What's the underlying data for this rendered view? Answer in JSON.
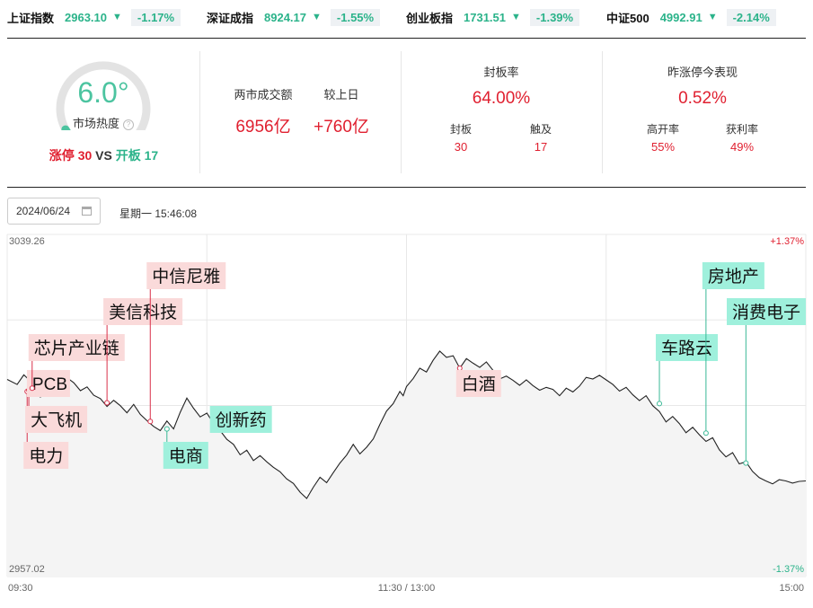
{
  "ticker": [
    {
      "name": "上证指数",
      "value": "2963.10",
      "arrow": "▼",
      "pct": "-1.17%"
    },
    {
      "name": "深证成指",
      "value": "8924.17",
      "arrow": "▼",
      "pct": "-1.55%"
    },
    {
      "name": "创业板指",
      "value": "1731.51",
      "arrow": "▼",
      "pct": "-1.39%"
    },
    {
      "name": "中证500",
      "value": "4992.91",
      "arrow": "▼",
      "pct": "-2.14%"
    }
  ],
  "heat": {
    "value": "6.0°",
    "value_num": 6.0,
    "label": "市场热度",
    "help_icon": "?",
    "limit_up_label": "涨停",
    "limit_up_count": "30",
    "vs": "VS",
    "open_label": "开板",
    "open_count": "17"
  },
  "turnover": {
    "label": "两市成交额",
    "value": "6956亿",
    "change_label": "较上日",
    "change_value": "+760亿"
  },
  "seal": {
    "label": "封板率",
    "value": "64.00%",
    "sealed_label": "封板",
    "sealed_value": "30",
    "touched_label": "触及",
    "touched_value": "17"
  },
  "yesterday": {
    "label": "昨涨停今表现",
    "value": "0.52%",
    "high_open_label": "高开率",
    "high_open_value": "55%",
    "profit_label": "获利率",
    "profit_value": "49%"
  },
  "date_picker": {
    "value": "2024/06/24",
    "icon": "calendar-icon"
  },
  "timestamp": "星期一 15:46:08",
  "chart_data": {
    "type": "line",
    "y_top_label": "3039.26",
    "y_bottom_label": "2957.02",
    "ylim": [
      2957.02,
      3039.26
    ],
    "right_top_label": "+1.37%",
    "right_bottom_label": "-1.37%",
    "x_ticks": [
      "09:30",
      "11:30 / 13:00",
      "15:00"
    ],
    "x_range_minutes": [
      0,
      240
    ],
    "series": [
      {
        "values": [
          [
            0,
            3004.4
          ],
          [
            3,
            3003.2
          ],
          [
            5,
            3005.5
          ],
          [
            7,
            3004.0
          ],
          [
            8,
            3001.0
          ],
          [
            10,
            3000.2
          ],
          [
            12,
            3002.8
          ],
          [
            14,
            3004.6
          ],
          [
            16,
            3002.5
          ],
          [
            18,
            3004.8
          ],
          [
            20,
            3003.6
          ],
          [
            22,
            3001.7
          ],
          [
            24,
            3002.6
          ],
          [
            26,
            3000.6
          ],
          [
            28,
            2999.8
          ],
          [
            30,
            2997.9
          ],
          [
            32,
            2999.4
          ],
          [
            34,
            2998.1
          ],
          [
            36,
            2996.4
          ],
          [
            38,
            2998.4
          ],
          [
            40,
            2996.0
          ],
          [
            42,
            2994.5
          ],
          [
            44,
            2993.1
          ],
          [
            46,
            2992.1
          ],
          [
            48,
            2994.4
          ],
          [
            50,
            2992.5
          ],
          [
            52,
            2996.5
          ],
          [
            54,
            2999.9
          ],
          [
            56,
            2997.5
          ],
          [
            58,
            2995.4
          ],
          [
            60,
            2996.3
          ],
          [
            62,
            2993.8
          ],
          [
            64,
            2992.1
          ],
          [
            66,
            2990.0
          ],
          [
            68,
            2988.8
          ],
          [
            70,
            2986.3
          ],
          [
            72,
            2987.4
          ],
          [
            74,
            2984.9
          ],
          [
            76,
            2986.1
          ],
          [
            78,
            2984.6
          ],
          [
            80,
            2983.3
          ],
          [
            82,
            2982.2
          ],
          [
            84,
            2980.5
          ],
          [
            86,
            2979.4
          ],
          [
            88,
            2977.3
          ],
          [
            90,
            2975.8
          ],
          [
            92,
            2978.5
          ],
          [
            94,
            2980.9
          ],
          [
            96,
            2979.6
          ],
          [
            98,
            2982.0
          ],
          [
            100,
            2984.3
          ],
          [
            102,
            2986.2
          ],
          [
            104,
            2988.8
          ],
          [
            106,
            2986.5
          ],
          [
            108,
            2988.1
          ],
          [
            110,
            2990.1
          ],
          [
            112,
            2993.6
          ],
          [
            114,
            2996.8
          ],
          [
            116,
            2998.6
          ],
          [
            118,
            3001.5
          ],
          [
            119,
            3000.5
          ],
          [
            120,
            3002.7
          ],
          [
            122,
            3004.6
          ],
          [
            124,
            3007.1
          ],
          [
            126,
            3006.2
          ],
          [
            128,
            3009.0
          ],
          [
            130,
            3011.2
          ],
          [
            132,
            3009.7
          ],
          [
            134,
            3010.1
          ],
          [
            136,
            3007.1
          ],
          [
            138,
            3009.4
          ],
          [
            140,
            3008.3
          ],
          [
            142,
            3007.3
          ],
          [
            144,
            3008.6
          ],
          [
            146,
            3006.6
          ],
          [
            148,
            3004.5
          ],
          [
            150,
            3005.2
          ],
          [
            152,
            3004.2
          ],
          [
            154,
            3003.0
          ],
          [
            156,
            3004.3
          ],
          [
            158,
            3002.9
          ],
          [
            160,
            3001.8
          ],
          [
            162,
            3002.5
          ],
          [
            164,
            3002.0
          ],
          [
            166,
            3000.5
          ],
          [
            168,
            3002.3
          ],
          [
            170,
            3001.4
          ],
          [
            172,
            3002.8
          ],
          [
            174,
            3004.9
          ],
          [
            176,
            3004.5
          ],
          [
            178,
            3005.4
          ],
          [
            180,
            3004.3
          ],
          [
            182,
            3003.2
          ],
          [
            184,
            3001.6
          ],
          [
            186,
            3002.5
          ],
          [
            188,
            3000.7
          ],
          [
            190,
            2999.3
          ],
          [
            192,
            3000.5
          ],
          [
            194,
            2998.1
          ],
          [
            196,
            2996.7
          ],
          [
            198,
            2994.2
          ],
          [
            200,
            2995.5
          ],
          [
            202,
            2993.8
          ],
          [
            204,
            2991.6
          ],
          [
            206,
            2992.9
          ],
          [
            208,
            2991.1
          ],
          [
            210,
            2989.5
          ],
          [
            212,
            2990.4
          ],
          [
            214,
            2987.5
          ],
          [
            216,
            2985.8
          ],
          [
            218,
            2986.8
          ],
          [
            220,
            2984.1
          ],
          [
            222,
            2984.6
          ],
          [
            224,
            2982.3
          ],
          [
            226,
            2980.8
          ],
          [
            228,
            2980.0
          ],
          [
            230,
            2979.3
          ],
          [
            232,
            2980.3
          ],
          [
            234,
            2980.0
          ],
          [
            236,
            2979.5
          ],
          [
            238,
            2979.9
          ],
          [
            240,
            2980.0
          ]
        ]
      }
    ],
    "annotations": [
      {
        "label": "电力",
        "t": 6,
        "price": 3001.5,
        "style": "up"
      },
      {
        "label": "大飞机",
        "t": 6.5,
        "price": 3001.8,
        "style": "up"
      },
      {
        "label": "PCB",
        "t": 7,
        "price": 3002.0,
        "style": "up"
      },
      {
        "label": "芯片产业链",
        "t": 7.5,
        "price": 3002.3,
        "style": "up"
      },
      {
        "label": "美信科技",
        "t": 30,
        "price": 2998.8,
        "style": "up"
      },
      {
        "label": "中信尼雅",
        "t": 43,
        "price": 2994.3,
        "style": "up"
      },
      {
        "label": "电商",
        "t": 48,
        "price": 2992.5,
        "style": "down"
      },
      {
        "label": "创新药",
        "t": 62,
        "price": 2993.0,
        "style": "down"
      },
      {
        "label": "白酒",
        "t": 136,
        "price": 3007.1,
        "style": "up"
      },
      {
        "label": "车路云",
        "t": 196,
        "price": 2998.6,
        "style": "down"
      },
      {
        "label": "房地产",
        "t": 210,
        "price": 2991.5,
        "style": "down"
      },
      {
        "label": "消费电子",
        "t": 222,
        "price": 2984.3,
        "style": "down"
      }
    ],
    "colors": {
      "line": "#222222",
      "fill": "#f4f4f4",
      "up_tag": "#fadada",
      "up_line": "#d9304a",
      "down_tag": "#9ff0dc",
      "down_line": "#39b996",
      "grid": "#e8e8e8",
      "up_text": "#e02030",
      "down_text": "#2bb38a",
      "axis_text": "#666666"
    }
  },
  "colors": {
    "up": "#e02030",
    "down": "#2bb38a",
    "gauge_track": "#e3e3e3",
    "gauge_fill": "#4cc4a0"
  }
}
